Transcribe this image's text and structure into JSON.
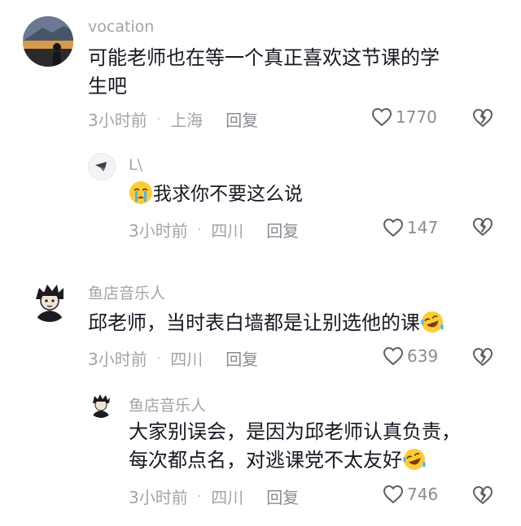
{
  "comments": [
    {
      "username": "vocation",
      "text_line1": "可能老师也在等一个真正喜欢这节课的学",
      "text_line2": "生吧",
      "time": "3小时前",
      "location": "上海",
      "reply_label": "回复",
      "likes": "1770"
    },
    {
      "username": "L\\",
      "text": "我求你不要这么说",
      "emoji": "crying-face",
      "time": "3小时前",
      "location": "四川",
      "reply_label": "回复",
      "likes": "147"
    },
    {
      "username": "鱼店音乐人",
      "text": "邱老师，当时表白墙都是让别选他的课",
      "emoji": "laughing-tears-face",
      "time": "3小时前",
      "location": "四川",
      "reply_label": "回复",
      "likes": "639"
    },
    {
      "username": "鱼店音乐人",
      "text_line1": "大家别误会，是因为邱老师认真负责，",
      "text_line2": "每次都点名，对逃课党不太友好",
      "emoji": "laughing-tears-face",
      "time": "3小时前",
      "location": "四川",
      "reply_label": "回复",
      "likes": "746"
    }
  ],
  "colors": {
    "text": "#161823",
    "meta": "#a3a4a9",
    "background": "#ffffff"
  },
  "icons": [
    "heart-outline-icon",
    "broken-heart-icon",
    "avatar",
    "emoji"
  ]
}
